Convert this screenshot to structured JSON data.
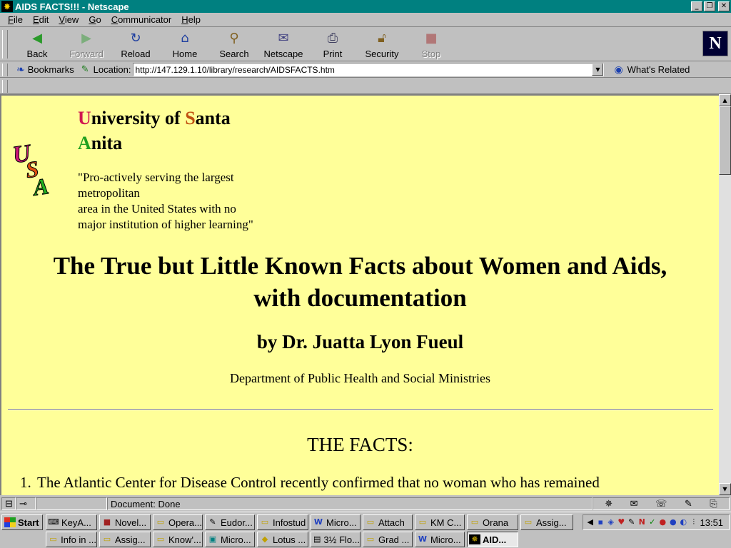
{
  "window": {
    "title": "AIDS FACTS!!! - Netscape"
  },
  "menu": [
    {
      "label": "File",
      "mnemonic": "F"
    },
    {
      "label": "Edit",
      "mnemonic": "E"
    },
    {
      "label": "View",
      "mnemonic": "V"
    },
    {
      "label": "Go",
      "mnemonic": "G"
    },
    {
      "label": "Communicator",
      "mnemonic": "C"
    },
    {
      "label": "Help",
      "mnemonic": "H"
    }
  ],
  "toolbar": {
    "back": "Back",
    "forward": "Forward",
    "reload": "Reload",
    "home": "Home",
    "search": "Search",
    "netscape": "Netscape",
    "print": "Print",
    "security": "Security",
    "stop": "Stop"
  },
  "location_bar": {
    "bookmarks_label": "Bookmarks",
    "location_label": "Location:",
    "url": "http://147.129.1.10/library/research/AIDSFACTS.htm",
    "whats_related": "What's Related"
  },
  "page": {
    "logo_text": "USA",
    "university_line1_initial": "U",
    "university_line1_rest": "niversity of ",
    "university_line1_initial2": "S",
    "university_line1_rest2": "anta",
    "university_line2_initial": "A",
    "university_line2_rest": "nita",
    "tagline_lines": [
      "\"Pro-actively serving the largest",
      "metropolitan",
      "area in the United States with no",
      "major institution of higher learning\""
    ],
    "main_title_line1": "The True but Little Known Facts about Women and Aids,",
    "main_title_line2": "with documentation",
    "byline": "by Dr. Juatta Lyon Fueul",
    "department": "Department of Public Health and Social Ministries",
    "facts_heading": "THE FACTS:",
    "facts": [
      {
        "number": "1.",
        "text": "The Atlantic Center for Disease Control recently confirmed that no woman who has remained"
      }
    ]
  },
  "status": {
    "text": "Document: Done"
  },
  "taskbar": {
    "start": "Start",
    "row1": [
      "KeyA...",
      "Novel...",
      "Opera...",
      "Eudor...",
      "Infostud",
      "Micro...",
      "Attach",
      "KM C...",
      "Orana",
      "Assig..."
    ],
    "row2": [
      "Info in ...",
      "Assig...",
      "Know'...",
      "Micro...",
      "Lotus ...",
      "3½ Flo...",
      "Grad ...",
      "Micro...",
      "AID..."
    ],
    "clock": "13:51"
  }
}
